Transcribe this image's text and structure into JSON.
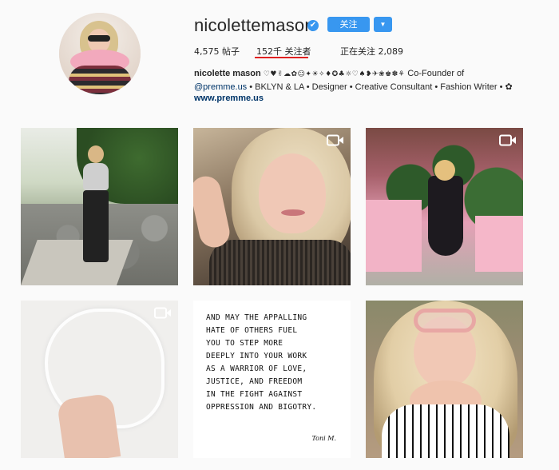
{
  "profile": {
    "username": "nicolettemason",
    "verified_glyph": "✔",
    "follow_label": "关注",
    "dropdown_glyph": "▼"
  },
  "stats": {
    "posts": "4,575 帖子",
    "followers": "152千 关注者",
    "following": "正在关注 2,089"
  },
  "bio": {
    "name": "nicolette mason",
    "emoji": "♡♥✌☁✿☺✦☀✧♦✪♣☼♡♠❥✈❀♚✽⚘",
    "cofounder": " Co-Founder of",
    "handle": "@premme.us",
    "rest": " • BKLYN & LA • Designer • Creative Consultant • Fashion Writer • ✿",
    "link": "www.premme.us"
  },
  "posts": [
    {
      "kind": "photo",
      "video": false
    },
    {
      "kind": "photo",
      "video": true
    },
    {
      "kind": "photo",
      "video": true
    },
    {
      "kind": "photo",
      "video": true
    },
    {
      "kind": "quote",
      "video": false,
      "quote_lines": [
        "AND MAY THE APPALLING",
        "HATE OF OTHERS FUEL",
        "YOU TO STEP MORE",
        "DEEPLY INTO YOUR WORK",
        "AS A WARRIOR OF LOVE,",
        "JUSTICE, AND FREEDOM",
        "IN THE FIGHT AGAINST",
        "OPPRESSION AND BIGOTRY."
      ],
      "signature": "Toni M."
    },
    {
      "kind": "photo",
      "video": false
    }
  ],
  "colors": {
    "accent": "#3897f0",
    "underline": "#e02020",
    "link": "#003569"
  },
  "icons": [
    "verified-badge-icon",
    "chevron-down-icon",
    "video-camera-icon"
  ]
}
